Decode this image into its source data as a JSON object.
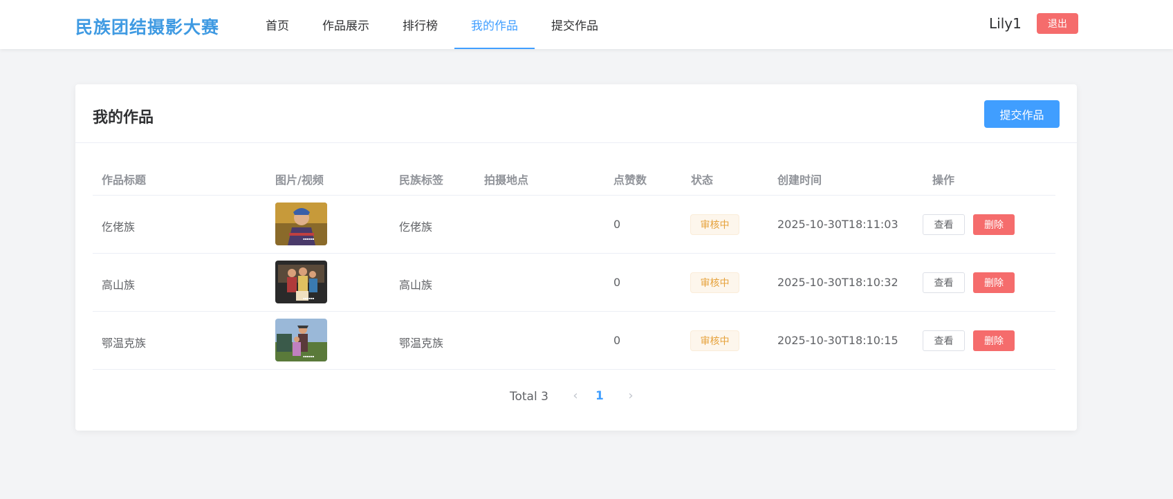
{
  "header": {
    "brand": "民族团结摄影大赛",
    "nav": [
      "首页",
      "作品展示",
      "排行榜",
      "我的作品",
      "提交作品"
    ],
    "active_nav": "我的作品",
    "user": "Lily1",
    "logout": "退出"
  },
  "card": {
    "title": "我的作品",
    "submit_label": "提交作品"
  },
  "table": {
    "headers": [
      "作品标题",
      "图片/视频",
      "民族标签",
      "拍摄地点",
      "点赞数",
      "状态",
      "创建时间",
      "操作"
    ],
    "rows": [
      {
        "title": "仡佬族",
        "thumb_icon": "photo-thumbnail-icon",
        "tag": "仡佬族",
        "location": "",
        "likes": "0",
        "status": "审核中",
        "created": "2025-10-30T18:11:03",
        "view": "查看",
        "delete": "删除"
      },
      {
        "title": "高山族",
        "thumb_icon": "photo-thumbnail-icon",
        "tag": "高山族",
        "location": "",
        "likes": "0",
        "status": "审核中",
        "created": "2025-10-30T18:10:32",
        "view": "查看",
        "delete": "删除"
      },
      {
        "title": "鄂温克族",
        "thumb_icon": "photo-thumbnail-icon",
        "tag": "鄂温克族",
        "location": "",
        "likes": "0",
        "status": "审核中",
        "created": "2025-10-30T18:10:15",
        "view": "查看",
        "delete": "删除"
      }
    ]
  },
  "pagination": {
    "total": "Total 3",
    "current_page": "1",
    "prev_icon": "chevron-left-icon",
    "next_icon": "chevron-right-icon"
  },
  "colors": {
    "primary": "#409eff",
    "brand": "#3f9ae2",
    "danger": "#f56c6c",
    "warning": "#e6a23c"
  }
}
